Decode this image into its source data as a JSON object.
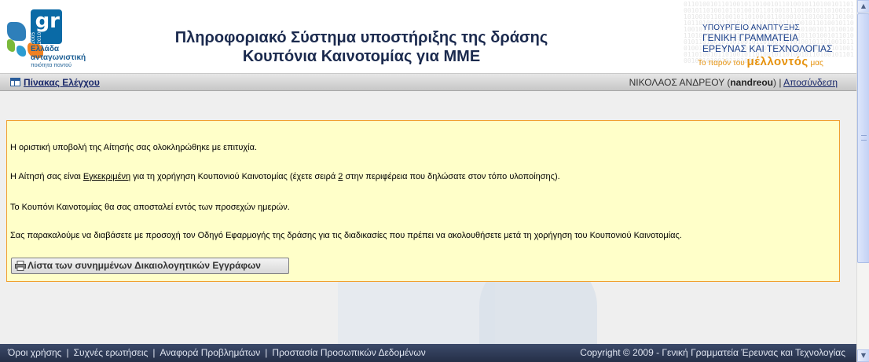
{
  "logo": {
    "brand": "gr",
    "years": "2005 2010",
    "slogan_line1": "Ελλάδα",
    "slogan_line2": "ανταγωνιστική",
    "slogan_line3": "ποιότητα παντού",
    "tile_colors": [
      "#2e7fba",
      "#7ab93a",
      "#f08120",
      "#2c9cd1"
    ]
  },
  "header": {
    "title_line1": "Πληροφοριακό Σύστημα υποστήριξης της δράσης",
    "title_line2": "Κουπόνια Καινοτομίας για ΜΜΕ"
  },
  "ministry": {
    "line1": "ΥΠΟΥΡΓΕΙΟ ΑΝΑΠΤΥΞΗΣ",
    "line2": "ΓΕΝΙΚΗ ΓΡΑΜΜΑΤΕΙΑ",
    "line3": "ΕΡΕΥΝΑΣ ΚΑΙ ΤΕΧΝΟΛΟΓΙΑΣ",
    "tagline_pre": "Το παρόν του",
    "tagline_big": "μέλλοντός",
    "tagline_post": "μας"
  },
  "nav": {
    "dashboard_label": "Πίνακας Ελέγχου",
    "user_name": "ΝΙΚΟΛΑΟΣ ΑΝΔΡΕΟΥ",
    "user_login": "nandreou",
    "logout_label": "Αποσύνδεση"
  },
  "message": {
    "p1": "Η οριστική υποβολή της Αίτησής σας ολοκληρώθηκε με επιτυχία.",
    "p2_pre": "Η Αίτησή σας είναι ",
    "p2_status": "Εγκεκριμένη",
    "p2_mid": " για τη χορήγηση Κουπονιού Καινοτομίας (έχετε σειρά ",
    "p2_rank": "2",
    "p2_post": " στην περιφέρεια που δηλώσατε στον τόπο υλοποίησης).",
    "p3": "Το Κουπόνι Καινοτομίας θα σας αποσταλεί εντός των προσεχών ημερών.",
    "p4": "Σας παρακαλούμε να διαβάσετε με προσοχή τον Οδηγό Εφαρμογής της δράσης για τις διαδικασίες που πρέπει να ακολουθήσετε μετά τη χορήγηση του Κουπονιού Καινοτομίας.",
    "button_label": "Λίστα των συνημμένων Δικαιολογητικών Εγγράφων"
  },
  "footer": {
    "links": [
      "Όροι χρήσης",
      "Συχνές ερωτήσεις",
      "Αναφορά Προβλημάτων",
      "Προστασία Προσωπικών Δεδομένων"
    ],
    "copyright": "Copyright © 2009 - Γενική Γραμματεία Έρευνας και Τεχνολογίας"
  },
  "colors": {
    "message_bg": "#ffffc9",
    "message_border": "#f0a030",
    "title_color": "#1b2a4e",
    "footer_bg": "#2f3b57",
    "tagline": "#e6920d"
  }
}
